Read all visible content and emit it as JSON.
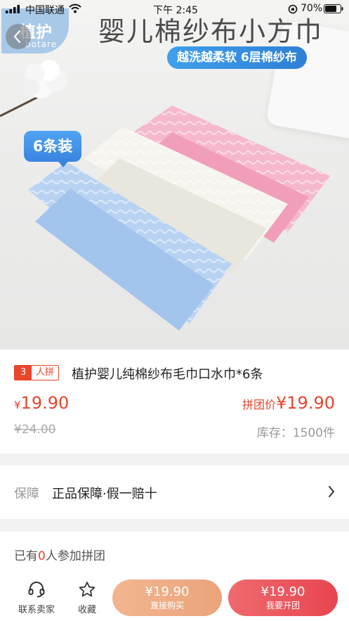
{
  "status_bar": {
    "carrier": "中国联通",
    "time": "下午 2:45",
    "battery": "70%"
  },
  "hero": {
    "title": "婴儿棉纱布小方巾",
    "pill": "越洗越柔软  6层棉纱布",
    "brand_name": "植护",
    "brand_sub": "botare",
    "qty_tag": "6条装",
    "towel_colors": [
      "#b8d3f2",
      "#f6f4ee",
      "#f5b8cd"
    ]
  },
  "product": {
    "group_count": "3",
    "group_label": "人拼",
    "title": "植护婴儿纯棉纱布毛巾口水巾*6条",
    "price_symbol": "¥",
    "price": "19.90",
    "group_price_label": "拼团价",
    "group_price": "¥19.90",
    "original_price": "¥24.00",
    "stock": "库存：1500件"
  },
  "guarantee": {
    "label": "保障",
    "value": "正品保障·假一赔十"
  },
  "group_info": {
    "prefix": "已有",
    "count": "0",
    "suffix": "人参加拼团"
  },
  "bottom_bar": {
    "contact_label": "联系卖家",
    "favorite_label": "收藏",
    "direct_price": "¥19.90",
    "direct_label": "直接购买",
    "group_price": "¥19.90",
    "group_label": "我要开团"
  },
  "colors": {
    "accent": "#e8452b",
    "direct_button": "#eba47a",
    "group_button": "#e8454f",
    "hero_pill": "#2e7fd6"
  }
}
